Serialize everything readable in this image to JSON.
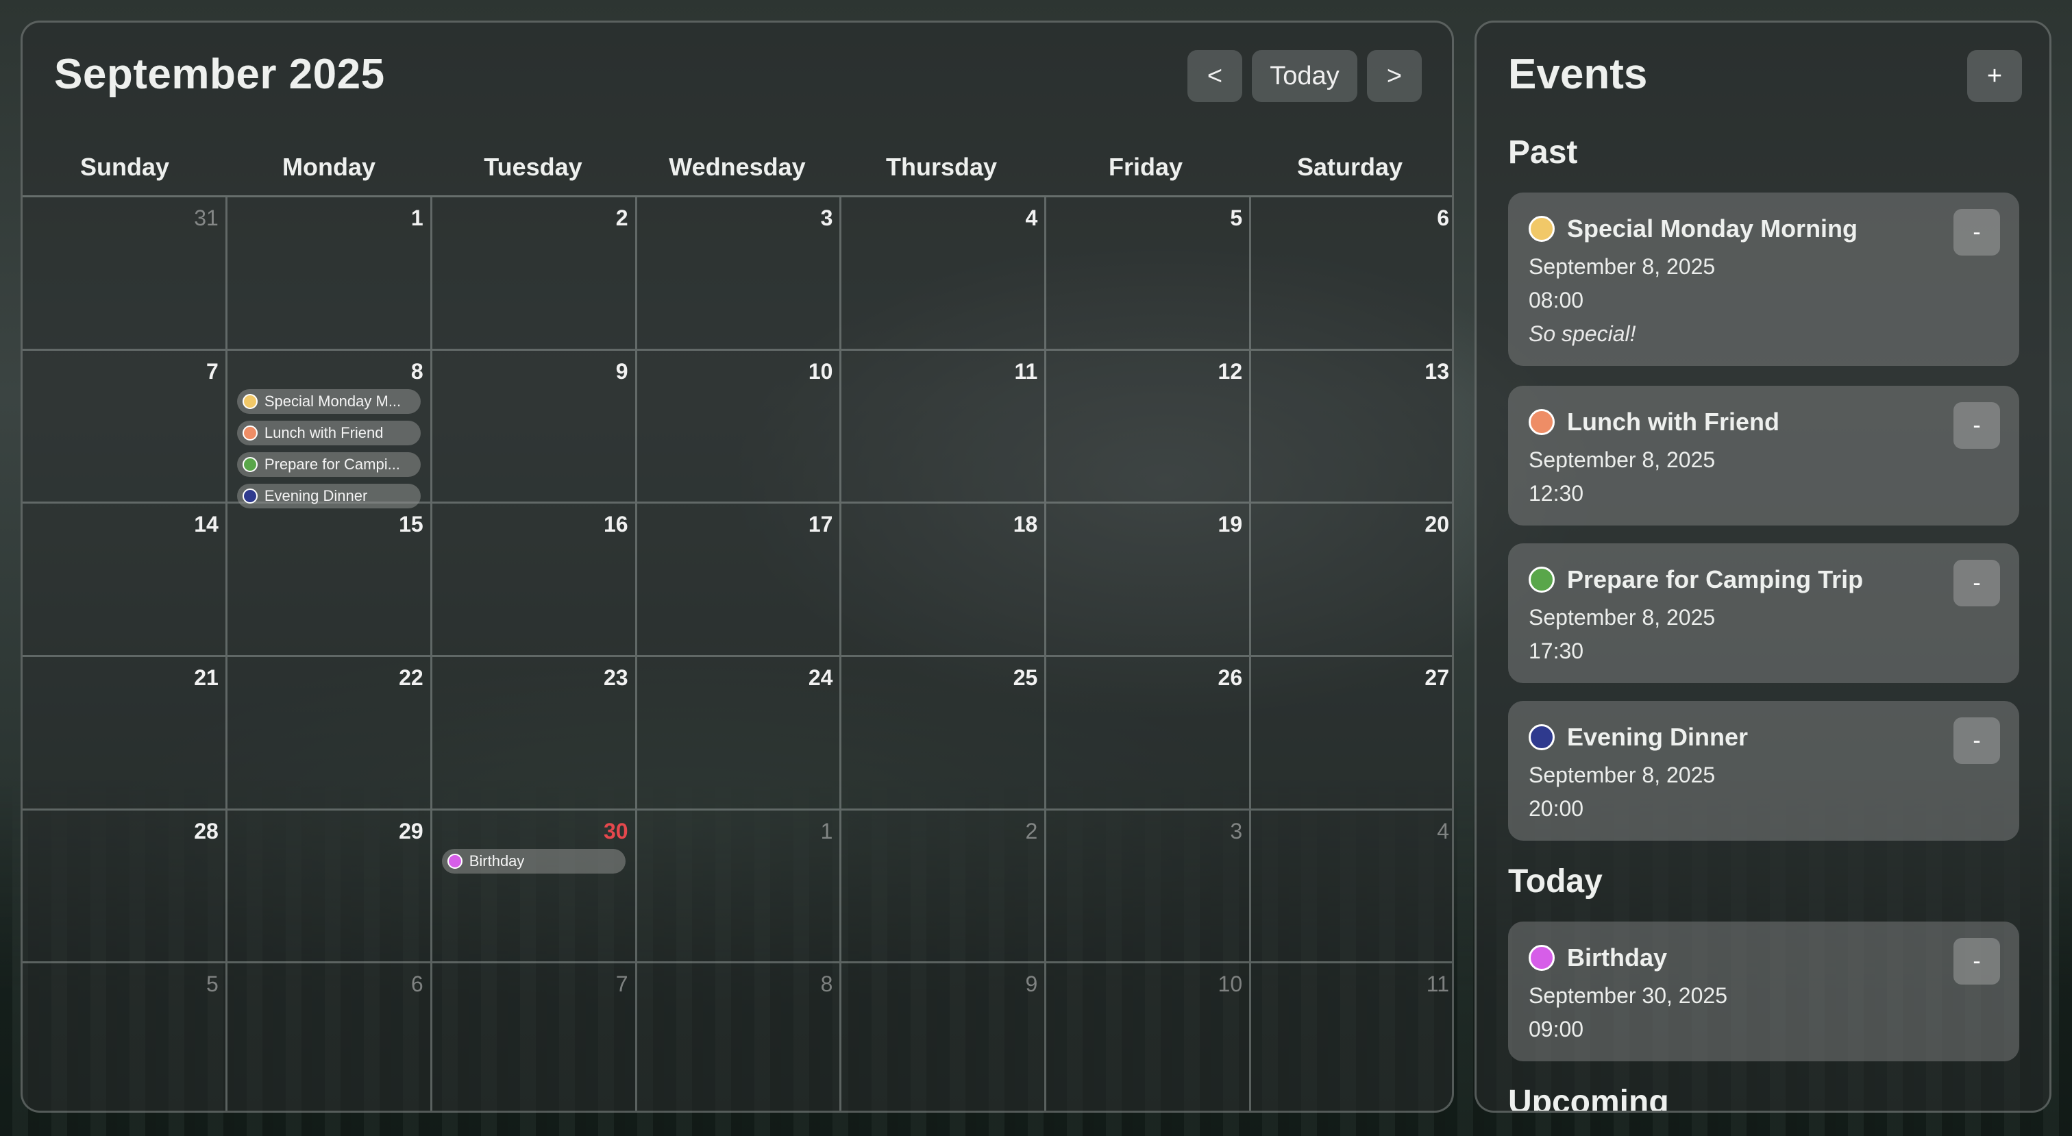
{
  "calendar": {
    "month_title": "September 2025",
    "prev_label": "<",
    "today_label": "Today",
    "next_label": ">",
    "weekdays": [
      "Sunday",
      "Monday",
      "Tuesday",
      "Wednesday",
      "Thursday",
      "Friday",
      "Saturday"
    ],
    "days": [
      {
        "num": "31",
        "other": true
      },
      {
        "num": "1"
      },
      {
        "num": "2"
      },
      {
        "num": "3"
      },
      {
        "num": "4"
      },
      {
        "num": "5"
      },
      {
        "num": "6"
      },
      {
        "num": "7"
      },
      {
        "num": "8",
        "events": [
          {
            "label": "Special Monday M...",
            "color": "#f1c868"
          },
          {
            "label": "Lunch with Friend",
            "color": "#ee8d66"
          },
          {
            "label": "Prepare for Campi...",
            "color": "#59a64a"
          },
          {
            "label": "Evening Dinner",
            "color": "#2f3a8e"
          }
        ]
      },
      {
        "num": "9"
      },
      {
        "num": "10"
      },
      {
        "num": "11"
      },
      {
        "num": "12"
      },
      {
        "num": "13"
      },
      {
        "num": "14"
      },
      {
        "num": "15"
      },
      {
        "num": "16"
      },
      {
        "num": "17"
      },
      {
        "num": "18"
      },
      {
        "num": "19"
      },
      {
        "num": "20"
      },
      {
        "num": "21"
      },
      {
        "num": "22"
      },
      {
        "num": "23"
      },
      {
        "num": "24"
      },
      {
        "num": "25"
      },
      {
        "num": "26"
      },
      {
        "num": "27"
      },
      {
        "num": "28"
      },
      {
        "num": "29"
      },
      {
        "num": "30",
        "today": true,
        "events": [
          {
            "label": "Birthday",
            "color": "#d65ee8"
          }
        ]
      },
      {
        "num": "1",
        "other": true
      },
      {
        "num": "2",
        "other": true
      },
      {
        "num": "3",
        "other": true
      },
      {
        "num": "4",
        "other": true
      },
      {
        "num": "5",
        "other": true
      },
      {
        "num": "6",
        "other": true
      },
      {
        "num": "7",
        "other": true
      },
      {
        "num": "8",
        "other": true
      },
      {
        "num": "9",
        "other": true
      },
      {
        "num": "10",
        "other": true
      },
      {
        "num": "11",
        "other": true
      }
    ]
  },
  "events_panel": {
    "title": "Events",
    "add_label": "+",
    "delete_label": "-",
    "past_heading": "Past",
    "today_heading": "Today",
    "upcoming_heading": "Upcoming",
    "past": [
      {
        "title": "Special Monday Morning",
        "date": "September 8, 2025",
        "time": "08:00",
        "note": "So special!",
        "color": "#f1c868"
      },
      {
        "title": "Lunch with Friend",
        "date": "September 8, 2025",
        "time": "12:30",
        "color": "#ee8d66"
      },
      {
        "title": "Prepare for Camping Trip",
        "date": "September 8, 2025",
        "time": "17:30",
        "color": "#59a64a"
      },
      {
        "title": "Evening Dinner",
        "date": "September 8, 2025",
        "time": "20:00",
        "color": "#2f3a8e"
      }
    ],
    "today": [
      {
        "title": "Birthday",
        "date": "September 30, 2025",
        "time": "09:00",
        "color": "#d65ee8"
      }
    ]
  }
}
